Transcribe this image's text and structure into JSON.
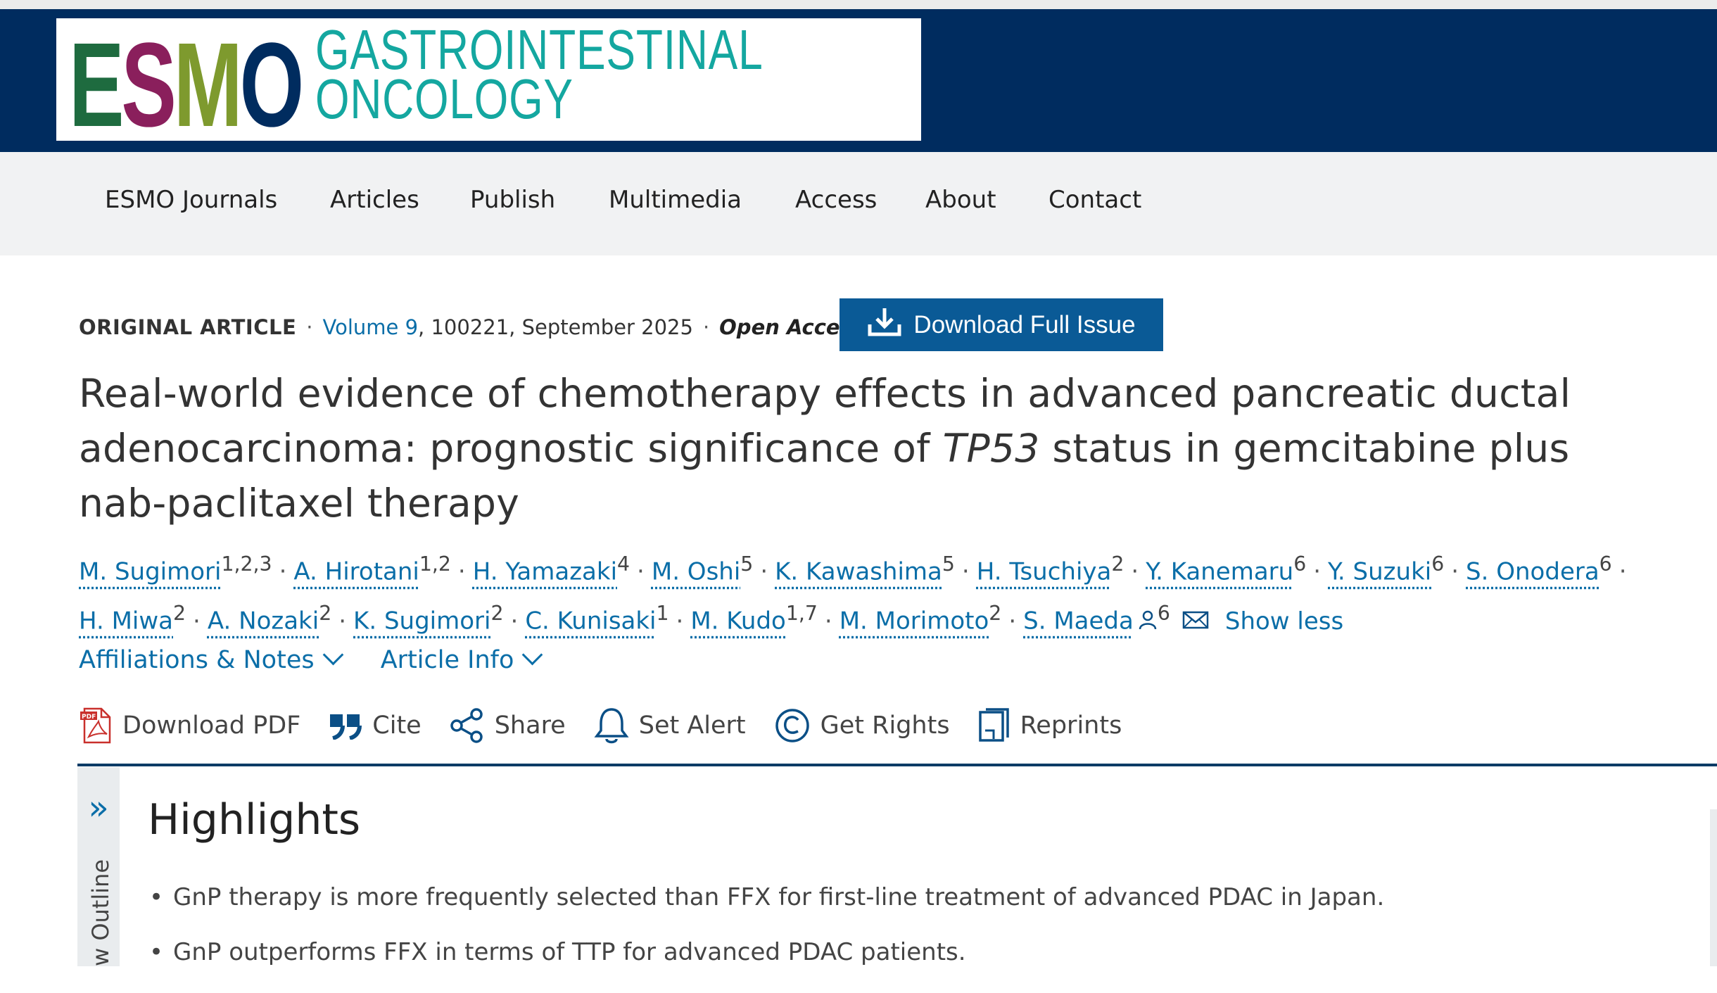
{
  "logo": {
    "letters": "ESMO",
    "line1": "GASTROINTESTINAL",
    "line2": "ONCOLOGY",
    "colors": [
      "#1e6b3f",
      "#8a1f5c",
      "#7e9a2e",
      "#002c5f"
    ]
  },
  "nav": {
    "items": [
      "ESMO Journals",
      "Articles",
      "Publish",
      "Multimedia",
      "Access",
      "About",
      "Contact"
    ]
  },
  "article": {
    "type": "ORIGINAL ARTICLE",
    "volume": "Volume 9",
    "citation": ", 100221, September 2025",
    "access": "Open Access",
    "download_issue": "Download Full Issue",
    "title_part1": "Real-world evidence of chemotherapy effects in advanced pancreatic ductal adenocarcinoma: prognostic significance of ",
    "title_italic": "TP53",
    "title_part2": " status in gemcitabine plus nab-paclitaxel therapy"
  },
  "authors": [
    {
      "name": "M. Sugimori",
      "aff": "1,2,3"
    },
    {
      "name": "A. Hirotani",
      "aff": "1,2"
    },
    {
      "name": "H. Yamazaki",
      "aff": "4"
    },
    {
      "name": "M. Oshi",
      "aff": "5"
    },
    {
      "name": "K. Kawashima",
      "aff": "5"
    },
    {
      "name": "H. Tsuchiya",
      "aff": "2"
    },
    {
      "name": "Y. Kanemaru",
      "aff": "6"
    },
    {
      "name": "Y. Suzuki",
      "aff": "6"
    },
    {
      "name": "S. Onodera",
      "aff": "6"
    },
    {
      "name": "H. Miwa",
      "aff": "2"
    },
    {
      "name": "A. Nozaki",
      "aff": "2"
    },
    {
      "name": "K. Sugimori",
      "aff": "2"
    },
    {
      "name": "C. Kunisaki",
      "aff": "1"
    },
    {
      "name": "M. Kudo",
      "aff": "1,7"
    },
    {
      "name": "M. Morimoto",
      "aff": "2"
    },
    {
      "name": "S. Maeda",
      "aff": "6"
    }
  ],
  "authors_toggle": "Show less",
  "dropdowns": {
    "affiliations": "Affiliations & Notes",
    "article_info": "Article Info"
  },
  "tools": {
    "download_pdf": "Download PDF",
    "cite": "Cite",
    "share": "Share",
    "set_alert": "Set Alert",
    "get_rights": "Get Rights",
    "reprints": "Reprints"
  },
  "outline": {
    "label": "w Outline"
  },
  "highlights": {
    "title": "Highlights",
    "items": [
      "GnP therapy is more frequently selected than FFX for first-line treatment of advanced PDAC in Japan.",
      "GnP outperforms FFX in terms of TTP for advanced PDAC patients."
    ]
  }
}
